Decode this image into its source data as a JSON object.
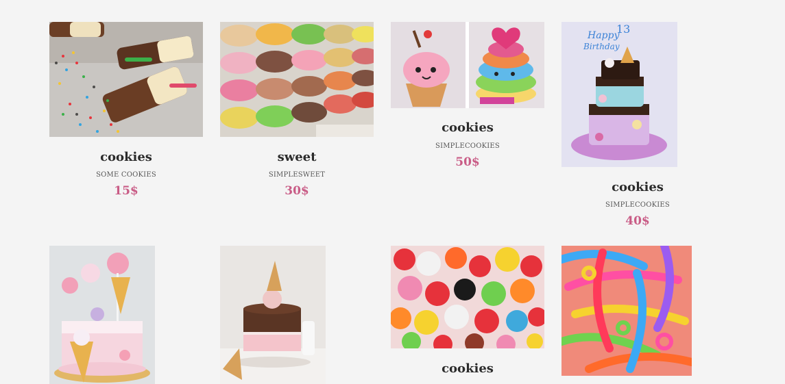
{
  "products": [
    {
      "title": "cookies",
      "subtitle": "SOME COOKIES",
      "price": "15$",
      "image": "chocolate-popsicles-with-sprinkles"
    },
    {
      "title": "sweet",
      "subtitle": "SIMPLESWEET",
      "price": "30$",
      "image": "stacked-macarons"
    },
    {
      "title": "cookies",
      "subtitle": "SIMPLECOOKIES",
      "price": "50$",
      "image": "kawaii-cakes"
    },
    {
      "title": "cookies",
      "subtitle": "SIMPLECOOKIES",
      "price": "40$",
      "image": "birthday-drip-cake"
    },
    {
      "image": "lollipop-cake"
    },
    {
      "image": "ice-cream-cone-cake"
    },
    {
      "title": "cookies",
      "image": "gummy-candies"
    },
    {
      "image": "sour-candy-pile"
    }
  ],
  "colors": {
    "background": "#f4f4f4",
    "title": "#2b2b2b",
    "price": "#c95c86"
  }
}
